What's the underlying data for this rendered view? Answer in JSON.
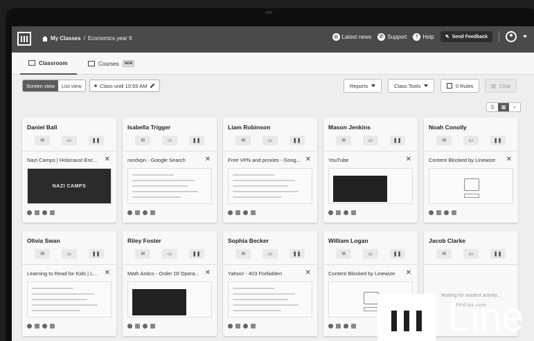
{
  "header": {
    "breadcrumb_root": "My Classes",
    "breadcrumb_sep": "/",
    "breadcrumb_current": "Economics year 9",
    "links": [
      "Latest news",
      "Support",
      "Help"
    ],
    "feedback_label": "Send Feedback"
  },
  "tabs": [
    {
      "label": "Classroom",
      "active": true
    },
    {
      "label": "Courses",
      "badge": "NEW"
    }
  ],
  "toolbar": {
    "view_screen": "Screen view",
    "view_list": "List view",
    "class_until": "Class until 10:55 AM",
    "reports": "Reports",
    "class_tools": "Class Tools",
    "rules": "0 Rules",
    "chat": "Chat"
  },
  "students": [
    {
      "name": "Daniel Ball",
      "tab": "Nazi Camps | Holocaust Enc...",
      "thumb": "NAZI CAMPS",
      "thumb_type": "hero"
    },
    {
      "name": "Isabella Trigger",
      "tab": "nordvpn - Google Search",
      "thumb_type": "page"
    },
    {
      "name": "Liam Robinson",
      "tab": "Free VPN and proxies - Goog...",
      "thumb_type": "page"
    },
    {
      "name": "Mason Jenkins",
      "tab": "YouTube",
      "thumb_type": "video"
    },
    {
      "name": "Noah Conolly",
      "tab": "Content Blocked by Linewize",
      "thumb_type": "blocked"
    },
    {
      "name": "Olivia Swan",
      "tab": "Learning to Read for Kids | L...",
      "thumb_type": "page"
    },
    {
      "name": "Riley Foster",
      "tab": "Math Antics - Order Of Opera...",
      "thumb_type": "video"
    },
    {
      "name": "Sophia Becker",
      "tab": "Yahoo! - 403 Forbidden",
      "thumb_type": "page"
    },
    {
      "name": "William Logan",
      "tab": "Content Blocked by Linewize",
      "thumb_type": "blocked"
    },
    {
      "name": "Jacob Clarke",
      "tab": "",
      "thumb_type": "waiting",
      "waiting": "Waiting for student activity...",
      "waiting2": "Find out more"
    }
  ],
  "watermark": {
    "text": "Line"
  },
  "colors": {
    "topbar": "#4a4a4a",
    "screen_bg": "#eeeeee"
  }
}
